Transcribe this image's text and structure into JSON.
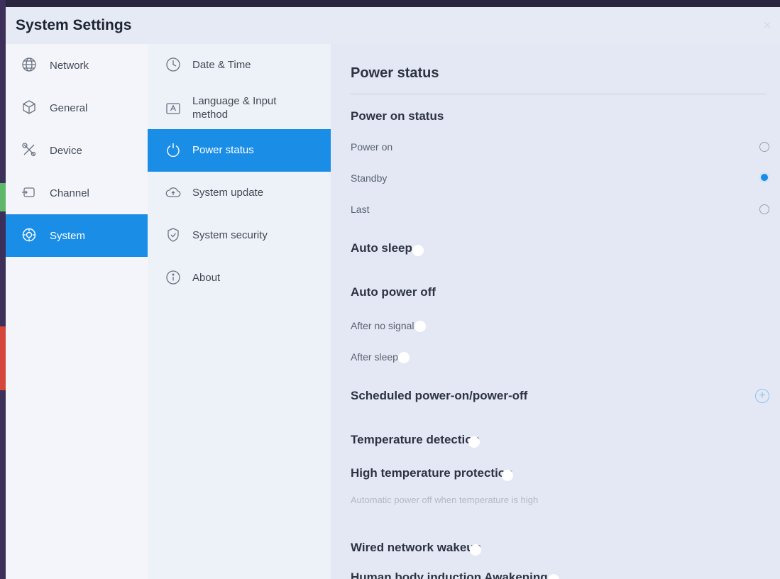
{
  "window": {
    "title": "System Settings",
    "close_symbol": "×"
  },
  "nav_primary": {
    "items": [
      {
        "label": "Network",
        "icon": "globe-icon"
      },
      {
        "label": "General",
        "icon": "cube-icon"
      },
      {
        "label": "Device",
        "icon": "tools-icon"
      },
      {
        "label": "Channel",
        "icon": "input-source-icon"
      },
      {
        "label": "System",
        "icon": "system-gear-icon"
      }
    ],
    "active_index": 4
  },
  "nav_secondary": {
    "items": [
      {
        "label": "Date & Time",
        "icon": "clock-icon"
      },
      {
        "label_line1": "Language & Input",
        "label_line2": "method",
        "icon": "language-icon"
      },
      {
        "label": "Power status",
        "icon": "power-icon"
      },
      {
        "label": "System update",
        "icon": "cloud-upload-icon"
      },
      {
        "label": "System security",
        "icon": "shield-icon"
      },
      {
        "label": "About",
        "icon": "info-icon"
      }
    ],
    "active_index": 2
  },
  "panel": {
    "title": "Power status",
    "power_on_status": {
      "heading": "Power on status",
      "options": [
        {
          "label": "Power on",
          "selected": false
        },
        {
          "label": "Standby",
          "selected": true
        },
        {
          "label": "Last",
          "selected": false
        }
      ]
    },
    "auto_sleep": {
      "label": "Auto sleep",
      "enabled": false
    },
    "auto_power_off": {
      "heading": "Auto power off",
      "after_no_signal": {
        "label": "After no signal",
        "enabled": false
      },
      "after_sleep": {
        "label": "After sleep",
        "enabled": false
      }
    },
    "scheduled": {
      "label": "Scheduled power-on/power-off",
      "add_symbol": "+"
    },
    "temperature_detection": {
      "label": "Temperature detection",
      "enabled": true
    },
    "high_temp_protection": {
      "label": "High temperature protection",
      "enabled": true,
      "hint": "Automatic power off when temperature is high"
    },
    "wired_network_wakeup": {
      "label": "Wired network wakeup",
      "enabled": true
    },
    "human_body_induction": {
      "label": "Human body induction Awakening",
      "enabled": false
    }
  },
  "colors": {
    "accent": "#1a8de6",
    "window_bg": "#e9edf6",
    "toggle_off": "#b8bec9"
  }
}
